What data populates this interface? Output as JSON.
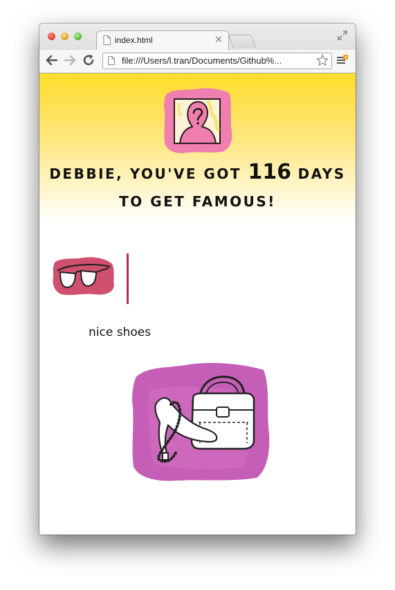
{
  "browser": {
    "tab_title": "index.html",
    "tab_close": "×",
    "url": "file:///Users/l.tran/Documents/Github%...",
    "icons": [
      "page-icon",
      "back-arrow-icon",
      "forward-arrow-icon",
      "reload-icon",
      "file-icon",
      "star-icon",
      "menu-icon",
      "expand-icon"
    ]
  },
  "page": {
    "headline_pre": "Debbie, you've got",
    "days": "116",
    "headline_post": "days to get famous!",
    "caption": "nice shoes",
    "images": [
      "mystery-person-icon",
      "sunglasses-icon",
      "shoes-and-handbag-icon"
    ]
  },
  "colors": {
    "gradient_top": "#fedd2a",
    "pink": "#ee7fae",
    "magenta": "#c45eb7",
    "divider": "#b32a57"
  }
}
